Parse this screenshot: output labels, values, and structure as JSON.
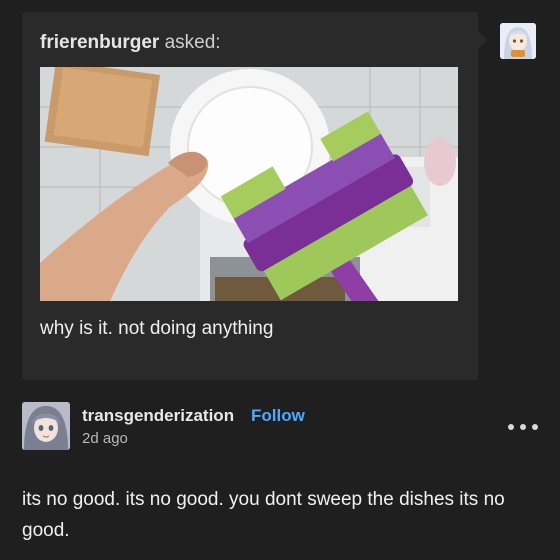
{
  "ask": {
    "asker_name": "frierenburger",
    "asker_suffix": " asked:",
    "question": "why is it. not doing anything",
    "image_icon": "photo-broom-sweeping-dishes",
    "asker_avatar_icon": "anime-avatar"
  },
  "post": {
    "author_name": "transgenderization",
    "follow_label": "Follow",
    "time": "2d ago",
    "body": "its no good. its no good. you dont sweep the dishes its no good.",
    "author_avatar_icon": "anime-avatar",
    "more_icon": "more-dots-icon"
  },
  "colors": {
    "background": "#1f1f1f",
    "ask_box": "#2a2a2a",
    "follow": "#4ea8ff",
    "text": "#f0f0f0"
  }
}
